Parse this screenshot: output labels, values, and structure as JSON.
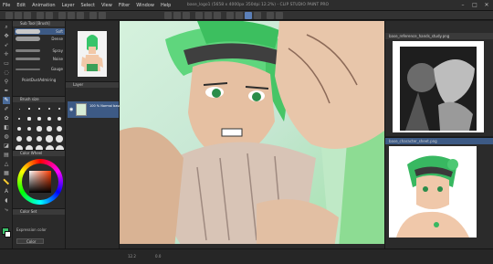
{
  "window": {
    "title": "base_logo1 (5658 x 4000px 350dpi 12.2%) - CLIP STUDIO PAINT PRO"
  },
  "menu": [
    "File",
    "Edit",
    "Animation",
    "Layer",
    "Select",
    "View",
    "Filter",
    "Window",
    "Help"
  ],
  "sub_tool": {
    "header": "Sub Tool [Brush]",
    "brushes": [
      "Soft",
      "Dense",
      "Spray",
      "Noise",
      "Gauge",
      "PointDustAdmiring"
    ],
    "active_index": 0
  },
  "brush_size": {
    "header": "Brush size",
    "sizes": [
      1,
      1.5,
      2,
      2.5,
      3,
      4,
      5,
      6,
      7,
      8,
      10,
      12,
      15,
      17,
      20,
      25,
      30,
      40,
      50,
      60,
      70,
      80,
      100,
      120,
      150
    ]
  },
  "color_wheel": {
    "header": "Color Wheel"
  },
  "color_set": {
    "header": "Color Set",
    "label": "Expression color",
    "select": "Color"
  },
  "layer": {
    "header": "Layer",
    "name": "100 % Normal\nbase_logo1 (1)"
  },
  "reference": {
    "top_header": "base_reference_hands_study.png",
    "bottom_header": "base_character_sheet.png"
  },
  "status": {
    "zoom": "12.2",
    "angle": "0.0"
  },
  "colors": {
    "main": "#3cc06a",
    "sub": "#ffffff",
    "accent": "#5b7fb8"
  }
}
